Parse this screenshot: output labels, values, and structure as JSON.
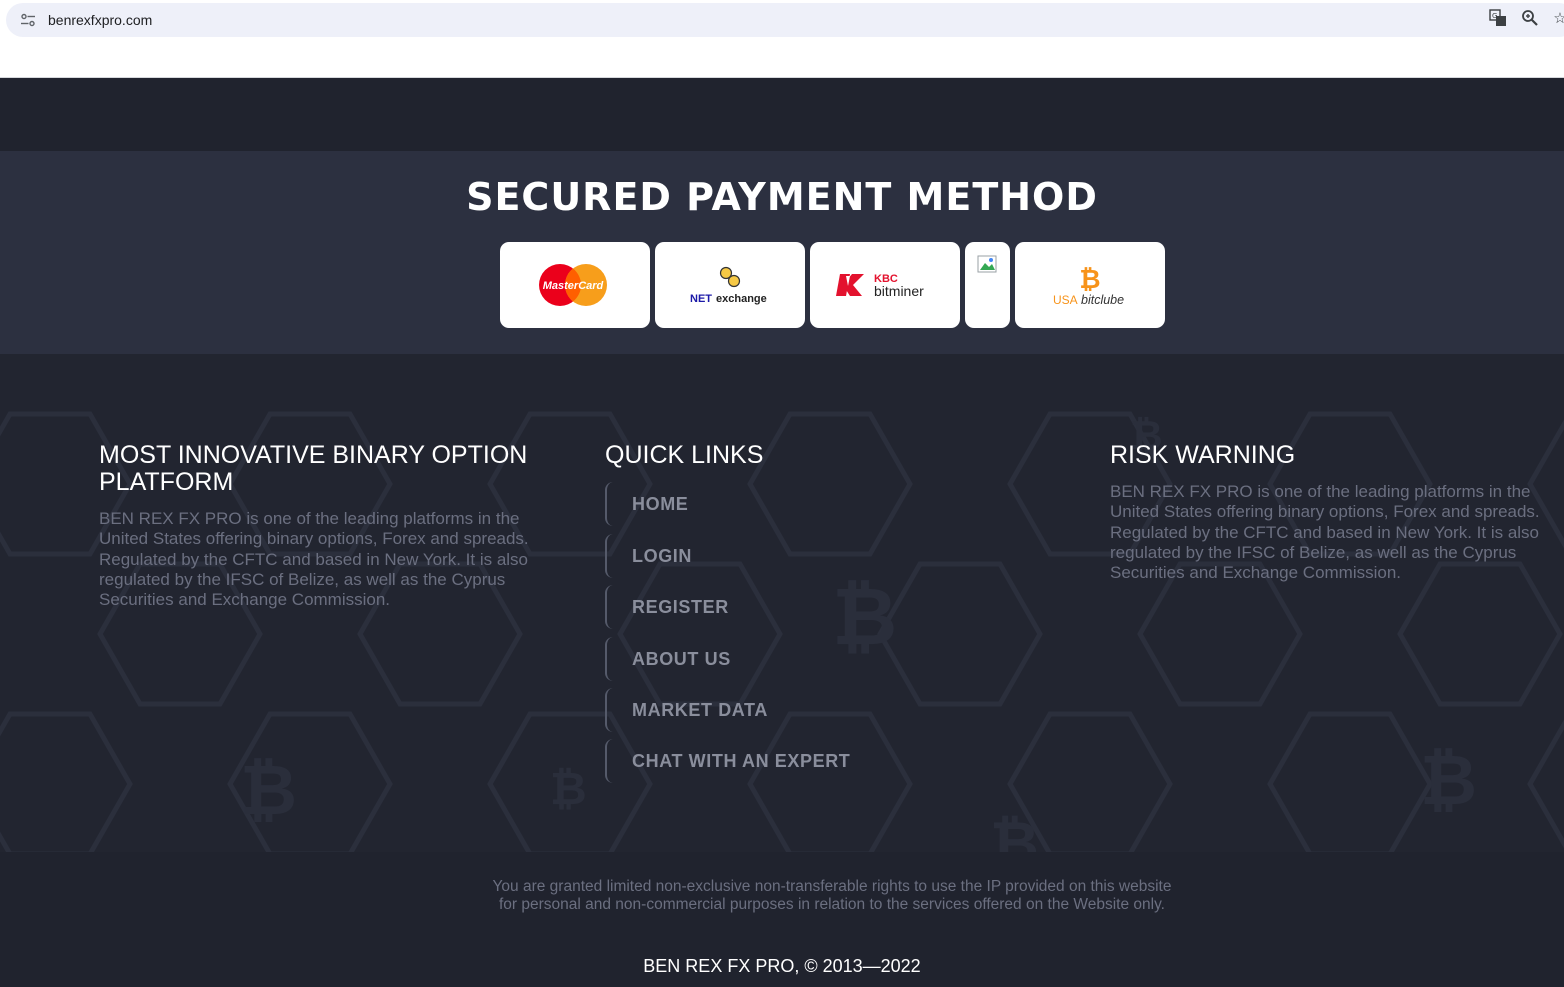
{
  "browser": {
    "url": "benrexfxpro.com"
  },
  "payment": {
    "title": "SECURED PAYMENT METHOD",
    "cards": [
      {
        "name": "MasterCard",
        "label": "MasterCard"
      },
      {
        "name": "NET exchange",
        "label_a": "NET",
        "label_b": "exchange"
      },
      {
        "name": "KBC bitminer",
        "label_a": "KBC",
        "label_b": "bitminer"
      },
      {
        "name": "broken image"
      },
      {
        "name": "USA bitclube",
        "label_a": "USA",
        "label_b": "bitclube"
      }
    ]
  },
  "footer": {
    "about": {
      "title": "MOST INNOVATIVE BINARY OPTION PLATFORM",
      "text": "BEN REX FX PRO is one of the leading platforms in the United States offering binary options, Forex and spreads. Regulated by the CFTC and based in New York. It is also regulated by the IFSC of Belize, as well as the Cyprus Securities and Exchange Commission."
    },
    "quick_links": {
      "title": "QUICK LINKS",
      "items": [
        "HOME",
        "LOGIN",
        "REGISTER",
        "ABOUT US",
        "MARKET DATA",
        "CHAT WITH AN EXPERT"
      ]
    },
    "risk": {
      "title": "RISK WARNING",
      "text": "BEN REX FX PRO is one of the leading platforms in the United States offering binary options, Forex and spreads. Regulated by the CFTC and based in New York. It is also regulated by the IFSC of Belize, as well as the Cyprus Securities and Exchange Commission."
    }
  },
  "bottom": {
    "legal": "You are granted limited non-exclusive non-transferable rights to use the IP provided on this website for personal and non-commercial purposes in relation to the services offered on the Website only.",
    "copyright": "BEN REX FX PRO, © 2013—2022"
  },
  "colors": {
    "page_bg": "#21232f",
    "payment_bg": "#2c3040",
    "mastercard_red": "#eb001b",
    "mastercard_orange": "#f79e1b",
    "kbc_red": "#e3122e",
    "bitcoin_orange": "#f7931a"
  }
}
